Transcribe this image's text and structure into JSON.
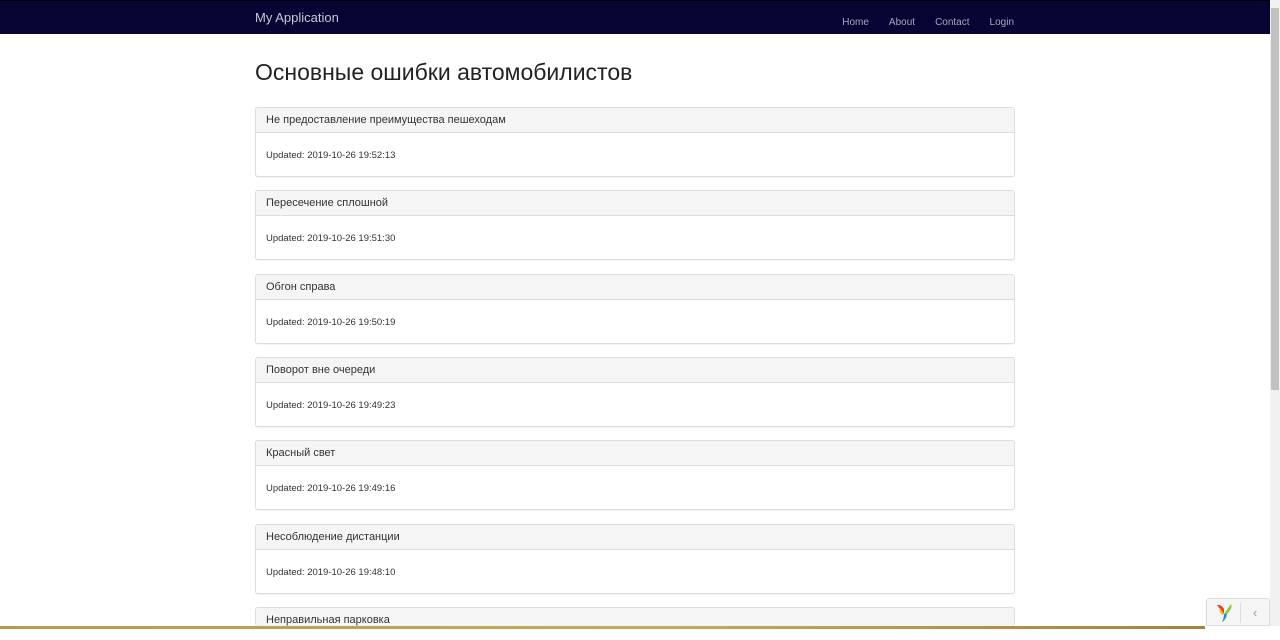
{
  "navbar": {
    "brand": "My Application",
    "links": [
      "Home",
      "About",
      "Contact",
      "Login"
    ]
  },
  "page": {
    "title": "Основные ошибки автомобилистов"
  },
  "panels": [
    {
      "title": "Не предоставление преимущества пешеходам",
      "updated": "Updated: 2019-10-26 19:52:13"
    },
    {
      "title": "Пересечение сплошной",
      "updated": "Updated: 2019-10-26 19:51:30"
    },
    {
      "title": "Обгон справа",
      "updated": "Updated: 2019-10-26 19:50:19"
    },
    {
      "title": "Поворот вне очереди",
      "updated": "Updated: 2019-10-26 19:49:23"
    },
    {
      "title": "Красный свет",
      "updated": "Updated: 2019-10-26 19:49:16"
    },
    {
      "title": "Несоблюдение дистанции",
      "updated": "Updated: 2019-10-26 19:48:10"
    },
    {
      "title": "Неправильная парковка",
      "updated": ""
    }
  ],
  "debug_toolbar": {
    "logo_icon": "yii-logo-icon",
    "collapse_icon": "chevron-left-icon",
    "collapse_glyph": "‹"
  },
  "colors": {
    "navbar_bg": "#060432",
    "panel_heading_bg": "#f5f5f5",
    "panel_border": "#dddddd"
  }
}
